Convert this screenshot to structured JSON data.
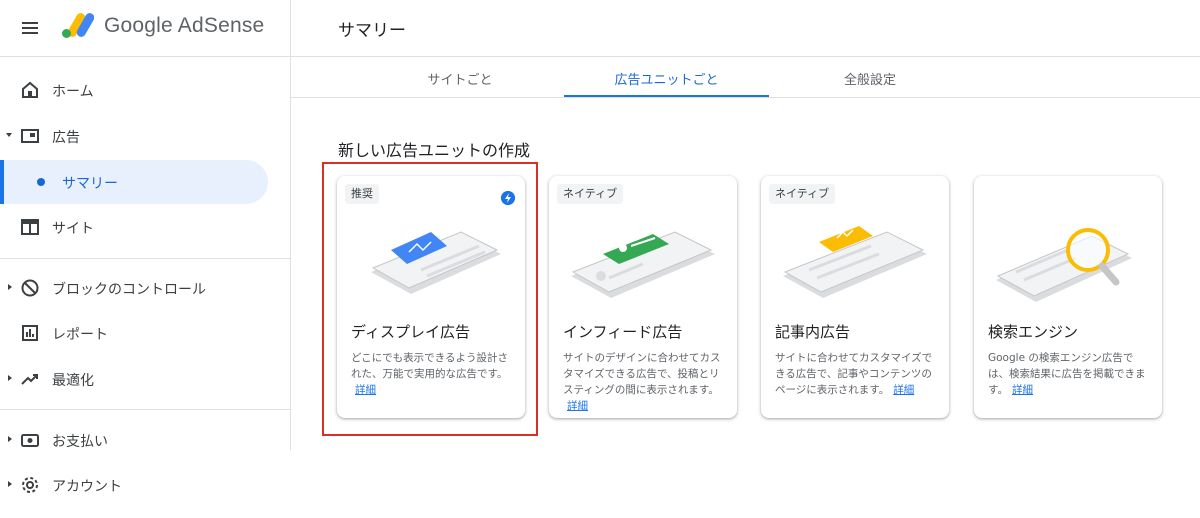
{
  "app": {
    "name": "Google AdSense"
  },
  "colors": {
    "accent": "#1a73e8",
    "active_bg": "#e8f0fe",
    "highlight_border": "#d93025"
  },
  "sidebar": {
    "items": [
      {
        "label": "ホーム",
        "icon": "home-icon"
      },
      {
        "label": "広告",
        "icon": "ads-icon",
        "expanded": true
      },
      {
        "label": "サマリー",
        "icon": "dot-icon",
        "active": true
      },
      {
        "label": "サイト",
        "icon": "site-icon"
      },
      {
        "label": "ブロックのコントロール",
        "icon": "block-icon"
      },
      {
        "label": "レポート",
        "icon": "report-icon"
      },
      {
        "label": "最適化",
        "icon": "trending-up-icon"
      },
      {
        "label": "お支払い",
        "icon": "payments-icon"
      },
      {
        "label": "アカウント",
        "icon": "gear-icon"
      }
    ]
  },
  "header": {
    "title": "サマリー"
  },
  "tabs": [
    {
      "label": "サイトごと"
    },
    {
      "label": "広告ユニットごと",
      "active": true
    },
    {
      "label": "全般設定"
    }
  ],
  "section": {
    "title": "新しい広告ユニットの作成"
  },
  "cards": [
    {
      "badge": "推奨",
      "title": "ディスプレイ広告",
      "description": "どこにでも表示できるよう設計された、万能で実用的な広告です。",
      "link": "詳細",
      "icon": "lightning-icon",
      "selected": true
    },
    {
      "badge": "ネイティブ",
      "title": "インフィード広告",
      "description": "サイトのデザインに合わせてカスタマイズできる広告で、投稿とリスティングの間に表示されます。",
      "link": "詳細"
    },
    {
      "badge": "ネイティブ",
      "title": "記事内広告",
      "description": "サイトに合わせてカスタマイズできる広告で、記事やコンテンツのページに表示されます。",
      "link": "詳細"
    },
    {
      "badge": "",
      "title": "検索エンジン",
      "description": "Google の検索エンジン広告では、検索結果に広告を掲載できます。",
      "link": "詳細"
    }
  ]
}
